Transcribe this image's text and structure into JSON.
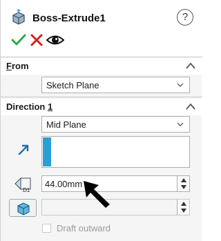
{
  "header": {
    "title": "Boss-Extrude1",
    "help_glyph": "?"
  },
  "actions": {
    "ok_icon": "check-icon",
    "cancel_icon": "close-icon",
    "preview_icon": "eye-icon"
  },
  "from": {
    "title_prefix": "F",
    "title_rest": "rom",
    "start_condition": "Sketch Plane"
  },
  "direction1": {
    "title": "Direction ",
    "title_number": "1",
    "end_condition": "Mid Plane",
    "depth_value": "44.00mm",
    "depth_icon_label": "D1",
    "draft_label": "Draft outward",
    "draft_checked": false
  },
  "colors": {
    "accent_blue": "#2a9fd4",
    "ok_green": "#2eaa3c",
    "cancel_red": "#d42020"
  }
}
